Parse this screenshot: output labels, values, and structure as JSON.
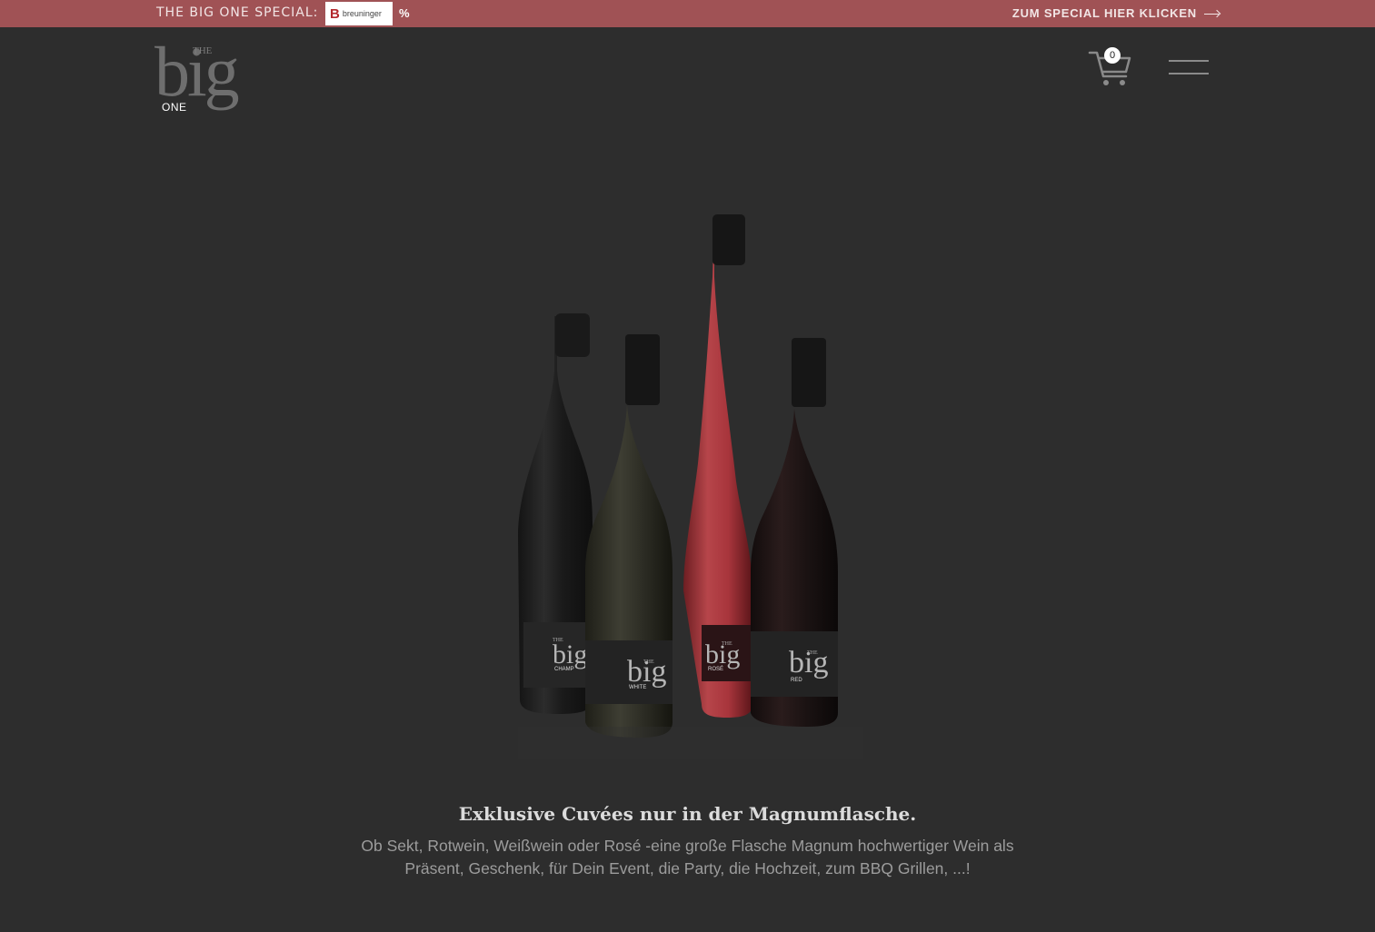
{
  "topbar": {
    "label": "THE BIG ONE SPECIAL:",
    "brand_logo_text": "breuninger",
    "percent": "%",
    "link_label": "ZUM SPECIAL HIER KLICKEN",
    "background_color": "#a05255"
  },
  "logo": {
    "the": "THE",
    "big": "big",
    "one": "ONE"
  },
  "cart": {
    "count": "0",
    "icon": "shopping-cart-icon"
  },
  "menu": {
    "icon": "hamburger-menu-icon"
  },
  "bottles": [
    {
      "label": "CHAMP",
      "brand": "big",
      "the": "THE"
    },
    {
      "label": "WHITE",
      "brand": "big",
      "the": "THE"
    },
    {
      "label": "ROSÉ",
      "brand": "big",
      "the": "THE"
    },
    {
      "label": "RED",
      "brand": "big",
      "the": "THE"
    }
  ],
  "main": {
    "headline": "Exklusive Cuvées nur in der Magnumflasche.",
    "subtext": "Ob Sekt, Rotwein, Weißwein oder Rosé -eine große Flasche Magnum hochwertiger Wein als Präsent, Geschenk, für Dein Event, die Party, die Hochzeit, zum BBQ Grillen, ...!"
  },
  "colors": {
    "background": "#2d2d2d",
    "accent": "#a05255",
    "rose_wine": "#a8353c"
  }
}
